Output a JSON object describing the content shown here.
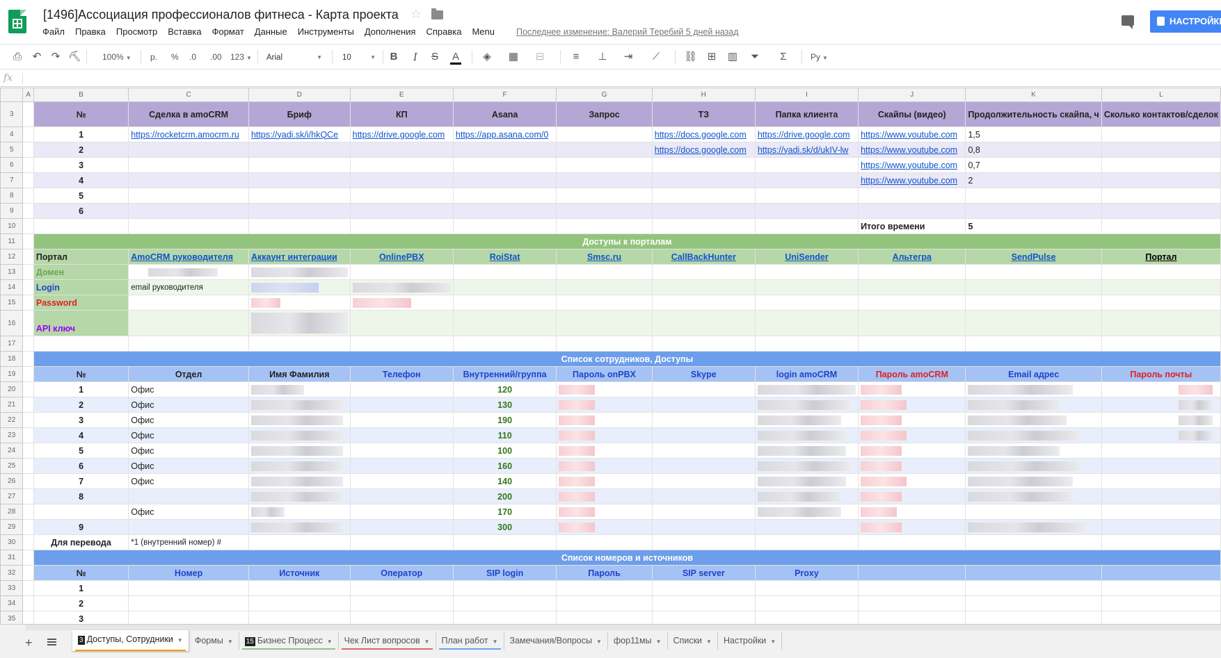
{
  "header": {
    "title": "[1496]Ассоциация профессионалов фитнеса - Карта проекта",
    "menu": [
      "Файл",
      "Правка",
      "Просмотр",
      "Вставка",
      "Формат",
      "Данные",
      "Инструменты",
      "Дополнения",
      "Справка",
      "Menu"
    ],
    "last_edit": "Последнее изменение: Валерий Теребий 5 дней назад",
    "share_label": "НАСТРОЙКИ ДОСТУПА"
  },
  "toolbar": {
    "zoom": "100%",
    "currency": "р.",
    "percent": "%",
    "dec_less": ".0",
    "dec_more": ".00",
    "format_more": "123",
    "font": "Arial",
    "font_size": "10",
    "input_tools": "Ру"
  },
  "formula_bar": {
    "label": "fx",
    "value": ""
  },
  "columns": [
    "A",
    "B",
    "C",
    "D",
    "E",
    "F",
    "G",
    "H",
    "I",
    "J",
    "K",
    "L"
  ],
  "headers_row3": [
    "№",
    "Сделка в amoCRM",
    "Бриф",
    "КП",
    "Asana",
    "Запрос",
    "ТЗ",
    "Папка клиента",
    "Скайпы (видео)",
    "Продолжительность скайпа, ч",
    "Сколько контактов/сделок"
  ],
  "project_rows": [
    {
      "n": "1",
      "deal": "https://rocketcrm.amocrm.ru",
      "brief": "https://yadi.sk/i/hkQCe",
      "kp": "https://drive.google.com",
      "asana": "https://app.asana.com/0",
      "tz": "https://docs.google.com",
      "folder": "https://drive.google.com",
      "skype": "https://www.youtube.com",
      "dur": "1,5"
    },
    {
      "n": "2",
      "deal": "",
      "brief": "",
      "kp": "",
      "asana": "",
      "tz": "https://docs.google.com",
      "folder": "https://yadi.sk/d/ukIV-lw",
      "skype": "https://www.youtube.com",
      "dur": "0,8"
    },
    {
      "n": "3",
      "deal": "",
      "brief": "",
      "kp": "",
      "asana": "",
      "tz": "",
      "folder": "",
      "skype": "https://www.youtube.com",
      "dur": "0,7"
    },
    {
      "n": "4",
      "deal": "",
      "brief": "",
      "kp": "",
      "asana": "",
      "tz": "",
      "folder": "",
      "skype": "https://www.youtube.com",
      "dur": "2"
    },
    {
      "n": "5",
      "deal": "",
      "brief": "",
      "kp": "",
      "asana": "",
      "tz": "",
      "folder": "",
      "skype": "",
      "dur": ""
    },
    {
      "n": "6",
      "deal": "",
      "brief": "",
      "kp": "",
      "asana": "",
      "tz": "",
      "folder": "",
      "skype": "",
      "dur": ""
    }
  ],
  "total_label": "Итого времени",
  "total_value": "5",
  "portals": {
    "title": "Доступы к порталам",
    "label": "Портал",
    "names": [
      "AmoCRM руководителя",
      "Аккаунт интеграции",
      "OnlinePBX",
      "RoiStat",
      "Smsc.ru",
      "CallBackHunter",
      "UniSender",
      "Альтегра",
      "SendPulse",
      "Портал"
    ],
    "domain": "Домен",
    "login": "Login",
    "password": "Password",
    "api": "API ключ",
    "login_amocrm": "email руководителя"
  },
  "employees": {
    "title": "Список сотрудников, Доступы",
    "headers": [
      "№",
      "Отдел",
      "Имя Фамилия",
      "Телефон",
      "Внутренний/группа",
      "Пароль onPBX",
      "Skype",
      "login amoCRM",
      "Пароль amoCRM",
      "Email адрес",
      "Пароль почты"
    ],
    "rows": [
      {
        "n": "1",
        "dept": "Офис",
        "ext": "120"
      },
      {
        "n": "2",
        "dept": "Офис",
        "ext": "130"
      },
      {
        "n": "3",
        "dept": "Офис",
        "ext": "190"
      },
      {
        "n": "4",
        "dept": "Офис",
        "ext": "110"
      },
      {
        "n": "5",
        "dept": "Офис",
        "ext": "100"
      },
      {
        "n": "6",
        "dept": "Офис",
        "ext": "160"
      },
      {
        "n": "7",
        "dept": "Офис",
        "ext": "140"
      },
      {
        "n": "8",
        "dept": "",
        "ext": "200"
      },
      {
        "n": "",
        "dept": "Офис",
        "ext": "170"
      },
      {
        "n": "9",
        "dept": "",
        "ext": "300"
      }
    ],
    "transfer_label": "Для перевода",
    "transfer_value": "*1 (внутренний номер) #"
  },
  "numbers": {
    "title": "Список номеров и источников",
    "headers": [
      "№",
      "Номер",
      "Источник",
      "Оператор",
      "SIP login",
      "Пароль",
      "SIP server",
      "Proxy"
    ],
    "rows": [
      "1",
      "2",
      "3"
    ]
  },
  "row_numbers": [
    "3",
    "4",
    "5",
    "6",
    "7",
    "8",
    "9",
    "10",
    "11",
    "12",
    "13",
    "14",
    "15",
    "16",
    "17",
    "18",
    "19",
    "20",
    "21",
    "22",
    "23",
    "24",
    "25",
    "26",
    "27",
    "28",
    "29",
    "30",
    "31",
    "32",
    "33",
    "34",
    "35"
  ],
  "tabs": [
    {
      "num": "3",
      "label": "Доступы, Сотрудники",
      "color": "#ff9900",
      "active": true
    },
    {
      "num": "",
      "label": "Формы",
      "color": "",
      "active": false
    },
    {
      "num": "15",
      "label": "Бизнес Процесс",
      "color": "#93c47d",
      "active": false
    },
    {
      "num": "",
      "label": "Чек Лист вопросов",
      "color": "#e06666",
      "active": false
    },
    {
      "num": "",
      "label": "План работ",
      "color": "#6d9eeb",
      "active": false
    },
    {
      "num": "",
      "label": "Замечания/Вопросы",
      "color": "",
      "active": false
    },
    {
      "num": "",
      "label": "фор11мы",
      "color": "",
      "active": false
    },
    {
      "num": "",
      "label": "Списки",
      "color": "",
      "active": false
    },
    {
      "num": "",
      "label": "Настройки",
      "color": "",
      "active": false
    }
  ]
}
